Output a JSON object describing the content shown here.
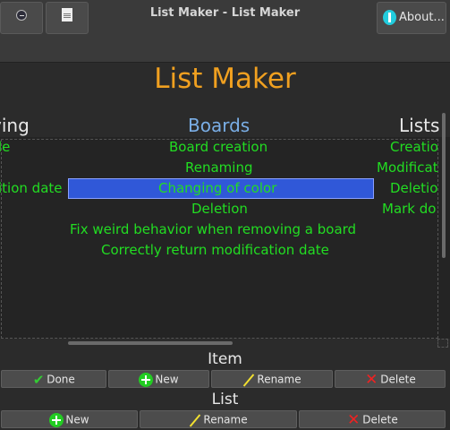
{
  "window": {
    "title": "List Maker - List Maker"
  },
  "toolbar": {
    "about_label": "About..."
  },
  "app": {
    "title": "List Maker"
  },
  "columns": {
    "left_header": "ving",
    "boards_header": "Boards",
    "lists_header": "Lists"
  },
  "left_items": [
    "le",
    "",
    "ition date"
  ],
  "board_items": [
    "Board creation",
    "Renaming",
    "Changing of color",
    "Deletion",
    "Fix weird behavior when removing a board",
    "Correctly return modification date"
  ],
  "selected_board_index": 2,
  "list_items": [
    "Creatio",
    "Modificat",
    "Deletio",
    "Mark do"
  ],
  "item_section": {
    "title": "Item",
    "buttons": {
      "done": "Done",
      "new": "New",
      "rename": "Rename",
      "delete": "Delete"
    }
  },
  "list_section": {
    "title": "List",
    "buttons": {
      "new": "New",
      "rename": "Rename",
      "delete": "Delete"
    }
  },
  "colors": {
    "title_accent": "#f0a020",
    "item_text": "#22dd22",
    "selection": "#3058d8",
    "boards_header": "#7aaee6"
  },
  "icons": [
    "menu-dot-icon",
    "boards-icon",
    "document-icon",
    "info-icon",
    "check-icon",
    "plus-icon",
    "pencil-icon",
    "x-icon"
  ]
}
